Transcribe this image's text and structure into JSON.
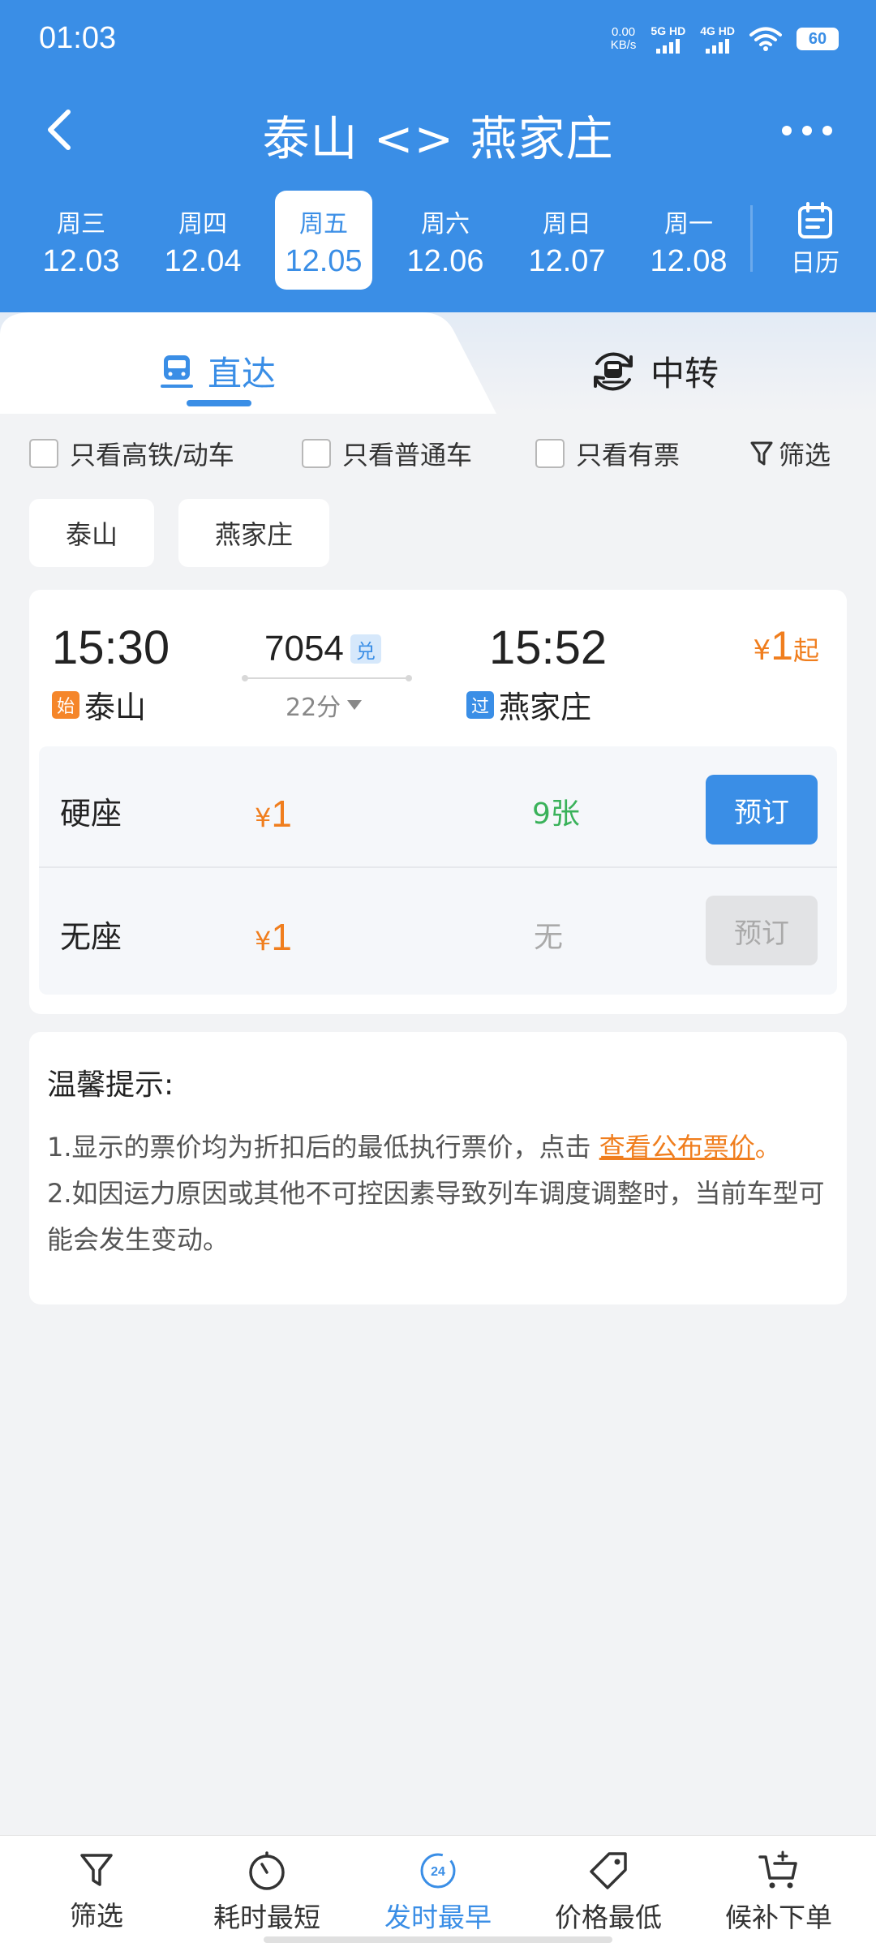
{
  "status": {
    "time": "01:03",
    "net_speed_value": "0.00",
    "net_speed_unit": "KB/s",
    "sim1": "5G HD",
    "sim2": "4G HD",
    "battery": "60"
  },
  "nav": {
    "title": "泰山 <> 燕家庄"
  },
  "dates": [
    {
      "week": "周三",
      "day": "12.03"
    },
    {
      "week": "周四",
      "day": "12.04"
    },
    {
      "week": "周五",
      "day": "12.05"
    },
    {
      "week": "周六",
      "day": "12.06"
    },
    {
      "week": "周日",
      "day": "12.07"
    },
    {
      "week": "周一",
      "day": "12.08"
    }
  ],
  "selected_date_index": 2,
  "calendar_label": "日历",
  "tabs": {
    "direct": "直达",
    "transfer": "中转"
  },
  "filters": {
    "high_speed": "只看高铁/动车",
    "normal": "只看普通车",
    "available": "只看有票",
    "filter_button": "筛选"
  },
  "stations": [
    "泰山",
    "燕家庄"
  ],
  "train": {
    "departure_time": "15:30",
    "arrival_time": "15:52",
    "number": "7054",
    "badge": "兑",
    "duration": "22分",
    "departure_station": "泰山",
    "departure_tag": "始",
    "arrival_station": "燕家庄",
    "arrival_tag": "过",
    "price_currency": "¥",
    "price_from": "1",
    "price_suffix": "起",
    "seats": [
      {
        "name": "硬座",
        "currency": "¥",
        "price": "1",
        "remaining": "9张",
        "book": "预订",
        "available": true
      },
      {
        "name": "无座",
        "currency": "¥",
        "price": "1",
        "remaining": "无",
        "book": "预订",
        "available": false
      }
    ]
  },
  "tips": {
    "title": "温馨提示:",
    "line1_prefix": "1.显示的票价均为折扣后的最低执行票价，点击 ",
    "line1_link": "查看公布票价",
    "line1_suffix": "。",
    "line2": "2.如因运力原因或其他不可控因素导致列车调度调整时，当前车型可能会发生变动。"
  },
  "bottom_bar": {
    "filter": "筛选",
    "shortest": "耗时最短",
    "earliest": "发时最早",
    "earliest_icon_text": "24",
    "cheapest": "价格最低",
    "waitlist": "候补下单"
  },
  "colors": {
    "primary": "#3a8ee6",
    "price": "#f07e1e",
    "available": "#3ab25a"
  }
}
